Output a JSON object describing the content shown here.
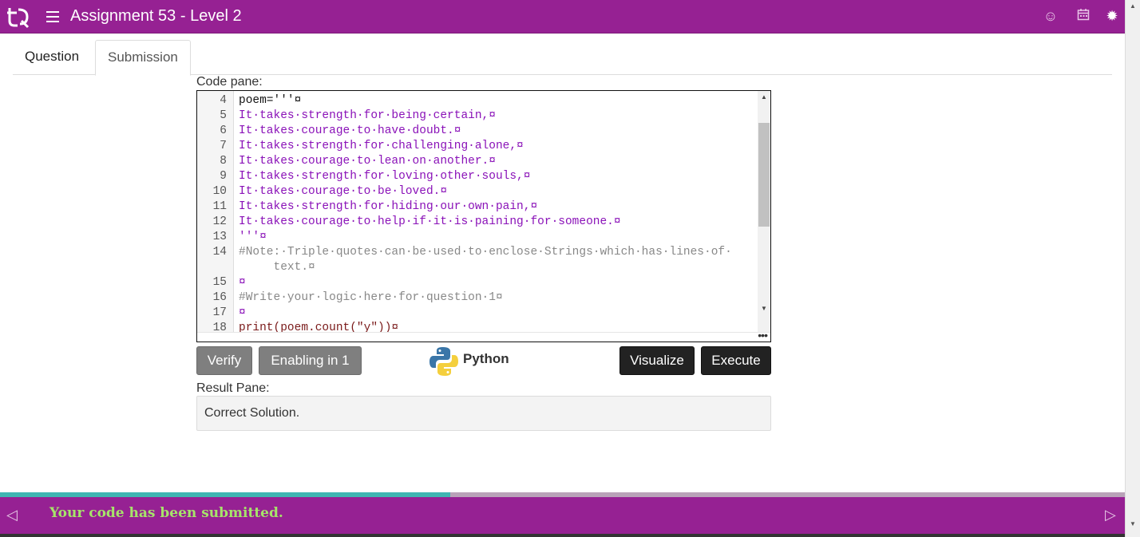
{
  "app": {
    "title": "Assignment 53 - Level 2"
  },
  "header_icons": [
    "smiley-icon",
    "calendar-icon",
    "settings-icon"
  ],
  "tabs": [
    {
      "label": "Question",
      "active": false
    },
    {
      "label": "Submission",
      "active": true
    }
  ],
  "code_pane": {
    "label": "Code pane:",
    "lines": [
      {
        "n": "4",
        "t": "poem='''¤"
      },
      {
        "n": "5",
        "t": "It·takes·strength·for·being·certain,¤"
      },
      {
        "n": "6",
        "t": "It·takes·courage·to·have·doubt.¤"
      },
      {
        "n": "7",
        "t": "It·takes·strength·for·challenging·alone,¤"
      },
      {
        "n": "8",
        "t": "It·takes·courage·to·lean·on·another.¤"
      },
      {
        "n": "9",
        "t": "It·takes·strength·for·loving·other·souls,¤"
      },
      {
        "n": "10",
        "t": "It·takes·courage·to·be·loved.¤"
      },
      {
        "n": "11",
        "t": "It·takes·strength·for·hiding·our·own·pain,¤"
      },
      {
        "n": "12",
        "t": "It·takes·courage·to·help·if·it·is·paining·for·someone.¤"
      },
      {
        "n": "13",
        "t": "'''¤"
      },
      {
        "n": "14",
        "t": "#Note:·Triple·quotes·can·be·used·to·enclose·Strings·which·has·lines·of·"
      },
      {
        "n": "",
        "t": "     text.¤"
      },
      {
        "n": "15",
        "t": "¤"
      },
      {
        "n": "16",
        "t": "#Write·your·logic·here·for·question·1¤"
      },
      {
        "n": "17",
        "t": "¤"
      },
      {
        "n": "18",
        "t": "print(poem.count(\"y\"))¤"
      }
    ]
  },
  "buttons": {
    "verify": "Verify",
    "enabling": "Enabling in 1",
    "visualize": "Visualize",
    "execute": "Execute"
  },
  "language": "Python",
  "result_pane": {
    "label": "Result Pane:",
    "text": "Correct Solution."
  },
  "footer": {
    "message": "Your code has been submitted.",
    "progress": 0.4
  },
  "colors": {
    "brand": "#962193",
    "progress_fill": "#3fb6b2",
    "footer_message": "#a6e46a"
  }
}
